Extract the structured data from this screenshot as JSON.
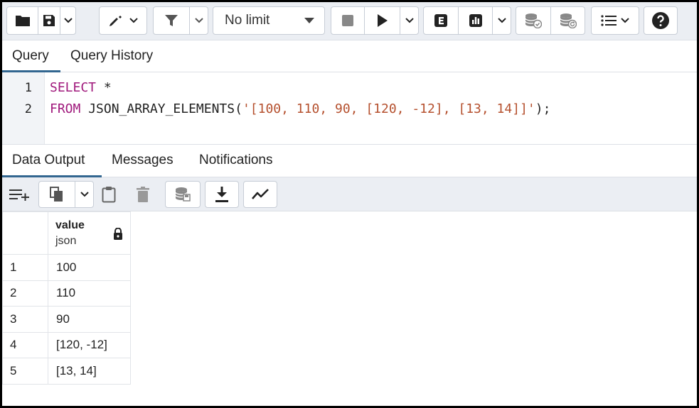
{
  "toolbar": {
    "limit_label": "No limit"
  },
  "query_tabs": [
    {
      "label": "Query"
    },
    {
      "label": "Query History"
    }
  ],
  "editor": {
    "lines": [
      {
        "num": "1",
        "keyword": "SELECT",
        "rest": " *",
        "string": "",
        "tail": ""
      },
      {
        "num": "2",
        "keyword": "FROM",
        "rest": " JSON_ARRAY_ELEMENTS(",
        "string": "'[100, 110, 90, [120, -12], [13, 14]]'",
        "tail": ");"
      }
    ]
  },
  "output_tabs": [
    {
      "label": "Data Output"
    },
    {
      "label": "Messages"
    },
    {
      "label": "Notifications"
    }
  ],
  "grid": {
    "column": {
      "name": "value",
      "type": "json"
    },
    "rows": [
      {
        "num": "1",
        "value": "100"
      },
      {
        "num": "2",
        "value": "110"
      },
      {
        "num": "3",
        "value": "90"
      },
      {
        "num": "4",
        "value": "[120, -12]"
      },
      {
        "num": "5",
        "value": "[13, 14]"
      }
    ]
  },
  "colors": {
    "keyword": "#a0197c",
    "string": "#b5502e",
    "active_tab": "#326690",
    "toolbar_bg": "#ebeef3"
  },
  "icons": [
    "folder-icon",
    "save-icon",
    "chevron-down-icon",
    "edit-icon",
    "filter-icon",
    "stop-icon",
    "play-icon",
    "explain-icon",
    "explain-analyze-icon",
    "commit-icon",
    "rollback-icon",
    "macros-icon",
    "help-icon",
    "add-row-icon",
    "copy-icon",
    "paste-icon",
    "delete-icon",
    "save-data-icon",
    "download-icon",
    "graph-icon",
    "lock-icon"
  ]
}
